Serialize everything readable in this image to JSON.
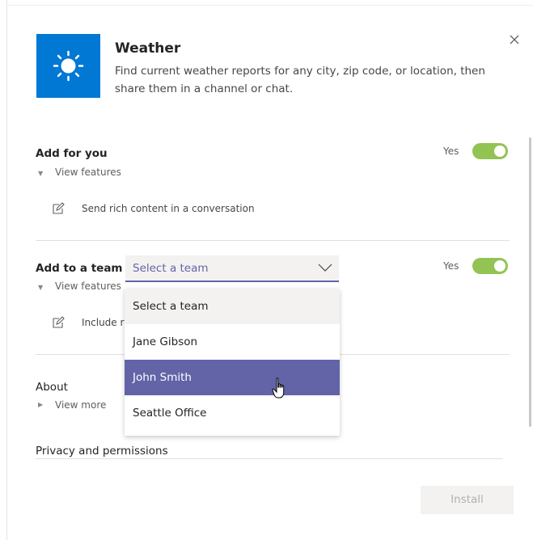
{
  "app": {
    "title": "Weather",
    "description": "Find current weather reports for any city, zip code, or location, then share them in a channel or chat.",
    "icon": "sun-icon",
    "accent_color": "#0078d4"
  },
  "close_icon": "close-icon",
  "add_for_you": {
    "title": "Add for you",
    "toggle_label": "Yes",
    "toggle_on": true,
    "view_features": "View features",
    "feature": "Send rich content in a conversation"
  },
  "add_to_team": {
    "title": "Add to a team",
    "select_value": "Select a team",
    "toggle_label": "Yes",
    "toggle_on": true,
    "view_features": "View features",
    "feature": "Include ri",
    "options": [
      "Select a team",
      "Jane Gibson",
      "John Smith",
      "Seattle Office"
    ],
    "highlighted_option": "John Smith"
  },
  "about": {
    "title": "About",
    "view_more": "View more"
  },
  "privacy": {
    "title": "Privacy and permissions"
  },
  "install_button": "Install",
  "colors": {
    "toggle_on": "#92c353",
    "brand_purple": "#6264a7",
    "install_disabled_bg": "#f3f2f1"
  }
}
